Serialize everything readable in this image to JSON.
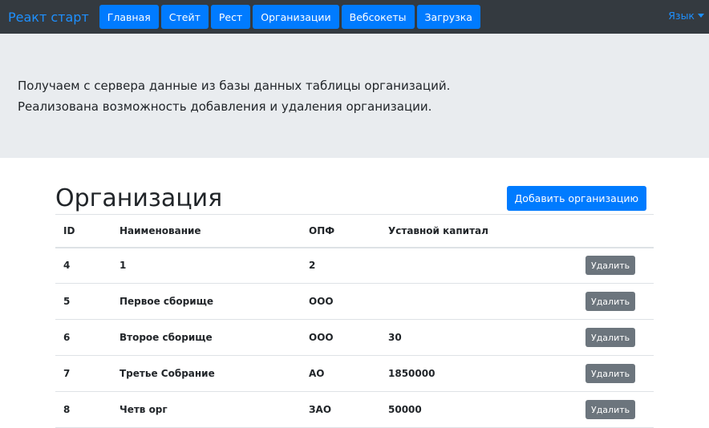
{
  "navbar": {
    "brand": "Реакт старт",
    "items": [
      "Главная",
      "Стейт",
      "Рест",
      "Организации",
      "Вебсокеты",
      "Загрузка"
    ],
    "lang": "Язык"
  },
  "jumbotron": {
    "line1": "Получаем с сервера данные из базы данных таблицы организаций.",
    "line2": "Реализована возможность добавления и удаления организации."
  },
  "page": {
    "title": "Организация",
    "add_button": "Добавить организацию"
  },
  "table": {
    "headers": [
      "ID",
      "Наименование",
      "ОПФ",
      "Уставной капитал"
    ],
    "rows": [
      {
        "id": "4",
        "name": "1",
        "opf": "2",
        "capital": ""
      },
      {
        "id": "5",
        "name": "Первое сборище",
        "opf": "ООО",
        "capital": ""
      },
      {
        "id": "6",
        "name": "Второе сборище",
        "opf": "ООО",
        "capital": "30"
      },
      {
        "id": "7",
        "name": "Третье Собрание",
        "opf": "АО",
        "capital": "1850000"
      },
      {
        "id": "8",
        "name": "Четв орг",
        "opf": "ЗАО",
        "capital": "50000"
      }
    ],
    "delete_label": "Удалить"
  }
}
